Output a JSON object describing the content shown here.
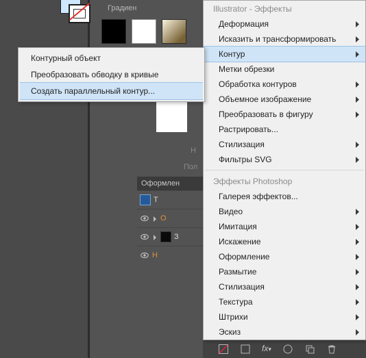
{
  "panel": {
    "gradient_label": "Градиен",
    "text_none_short": "Н",
    "text_half": "Пол",
    "appearance_header": "Оформлен",
    "appearance_rows": [
      {
        "label": "Т"
      },
      {
        "label": "О"
      },
      {
        "label": "З"
      },
      {
        "label": "Н"
      }
    ]
  },
  "menu_right": {
    "section1_title": "Illustrator - Эффекты",
    "section1_items": [
      {
        "label": "Деформация",
        "submenu": true,
        "selected": false
      },
      {
        "label": "Исказить и трансформировать",
        "submenu": true,
        "selected": false
      },
      {
        "label": "Контур",
        "submenu": true,
        "selected": true
      },
      {
        "label": "Метки обрезки",
        "submenu": false,
        "selected": false
      },
      {
        "label": "Обработка контуров",
        "submenu": true,
        "selected": false
      },
      {
        "label": "Объемное изображение",
        "submenu": true,
        "selected": false
      },
      {
        "label": "Преобразовать в фигуру",
        "submenu": true,
        "selected": false
      },
      {
        "label": "Растрировать...",
        "submenu": false,
        "selected": false
      },
      {
        "label": "Стилизация",
        "submenu": true,
        "selected": false
      },
      {
        "label": "Фильтры SVG",
        "submenu": true,
        "selected": false
      }
    ],
    "section2_title": "Эффекты Photoshop",
    "section2_items": [
      {
        "label": "Галерея эффектов...",
        "submenu": false
      },
      {
        "label": "Видео",
        "submenu": true
      },
      {
        "label": "Имитация",
        "submenu": true
      },
      {
        "label": "Искажение",
        "submenu": true
      },
      {
        "label": "Оформление",
        "submenu": true
      },
      {
        "label": "Размытие",
        "submenu": true
      },
      {
        "label": "Стилизация",
        "submenu": true
      },
      {
        "label": "Текстура",
        "submenu": true
      },
      {
        "label": "Штрихи",
        "submenu": true
      },
      {
        "label": "Эскиз",
        "submenu": true
      }
    ]
  },
  "menu_left": {
    "items": [
      {
        "label": "Контурный объект",
        "selected": false
      },
      {
        "label": "Преобразовать обводку в кривые",
        "selected": false
      },
      {
        "label": "Создать параллельный контур...",
        "selected": true
      }
    ]
  }
}
